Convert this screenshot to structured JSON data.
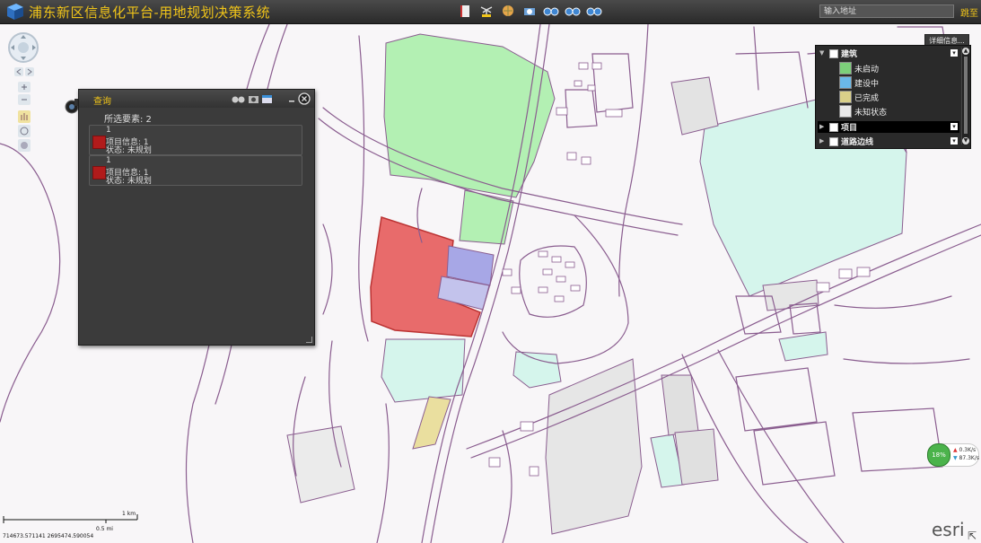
{
  "header": {
    "title": "浦东新区信息化平台-用地规划决策系统",
    "address_placeholder": "输入地址",
    "go_label": "跳至",
    "toolbar_icons": [
      "book-icon",
      "palm-icon",
      "globe-icon",
      "camera-icon",
      "binoculars-blue-icon",
      "binoculars-blue-icon",
      "binoculars-blue-icon"
    ]
  },
  "query_panel": {
    "title": "查询",
    "selected_count": "所选要素: 2",
    "items": [
      {
        "id": "1",
        "project": "项目信息: 1",
        "status": "状态: 未规划"
      },
      {
        "id": "1",
        "project": "项目信息: 1",
        "status": "状态: 未规划"
      }
    ]
  },
  "legend": {
    "tab_label": "详细信息...",
    "groups": [
      {
        "label": "建筑",
        "expanded": true,
        "items": [
          {
            "label": "未启动",
            "color": "#7ccf7a"
          },
          {
            "label": "建设中",
            "color": "#6ab8e8"
          },
          {
            "label": "已完成",
            "color": "#d9d089"
          },
          {
            "label": "未知状态",
            "color": "#e8e8e8"
          }
        ]
      },
      {
        "label": "项目",
        "expanded": false
      },
      {
        "label": "道路边线",
        "expanded": false
      }
    ]
  },
  "speed": {
    "percent": "18%",
    "up": "0.3K/s",
    "down": "87.3K/s"
  },
  "scalebar": {
    "km_label": "1 km",
    "mi_label": "0.5 mi"
  },
  "coords": "714673.571141 2695474.590054",
  "attribution": "esri",
  "colors": {
    "accent": "#f0c419",
    "selected_parcel": "#e86b6b",
    "planned_blue": "#a7a7e6",
    "green_parcel": "#b3f0b3",
    "teal_parcel": "#d5f5ec",
    "road": "#8a5d8f"
  }
}
